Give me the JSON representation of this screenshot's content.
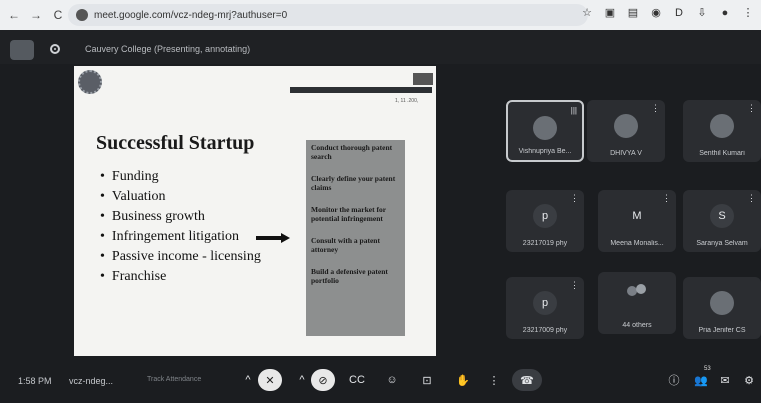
{
  "browser": {
    "back_glyph": "←",
    "forward_glyph": "→",
    "reload_glyph": "C",
    "url": "meet.google.com/vcz-ndeg-mrj?authuser=0",
    "right_icons": [
      "star-icon",
      "extension-icon",
      "extension-icon-2",
      "extension-icon-3",
      "extension-icon-4",
      "download-icon",
      "profile-icon",
      "menu-icon"
    ],
    "right_glyphs": [
      "☆",
      "▣",
      "▤",
      "◉",
      "D",
      "⇩",
      "●",
      "⋮"
    ]
  },
  "meet": {
    "presenting_label": "Cauvery College (Presenting, annotating)"
  },
  "slide": {
    "tiny_label": "1, 11 .200,",
    "title": "Successful Startup",
    "bullets": [
      "Funding",
      "Valuation",
      "Business growth",
      "Infringement litigation",
      "Passive income - licensing",
      "Franchise"
    ],
    "steps": [
      "Conduct thorough patent search",
      "Clearly define your patent claims",
      "Monitor the market for potential infringement",
      "Consult with a patent attorney",
      "Build a defensive patent portfolio"
    ]
  },
  "participants": [
    {
      "name": "Vishnupriya Be...",
      "avatar": "",
      "kind": "photo",
      "mic": "|||"
    },
    {
      "name": "DHIVYA V",
      "avatar": "",
      "kind": "photo"
    },
    {
      "name": "Senthil Kumari",
      "avatar": "",
      "kind": "photo"
    },
    {
      "name": "23217019 phy",
      "avatar": "p",
      "kind": "letter"
    },
    {
      "name": "Meena Monalis...",
      "avatar": "M",
      "kind": "plain"
    },
    {
      "name": "Saranya Selvam",
      "avatar": "S",
      "kind": "letter"
    },
    {
      "name": "23217009 phy",
      "avatar": "p",
      "kind": "letter"
    },
    {
      "name": "44 others",
      "avatar": "",
      "kind": "others"
    },
    {
      "name": "Pria Jenifer CS",
      "avatar": "",
      "kind": "photo"
    }
  ],
  "toolbar": {
    "time": "1:58 PM",
    "code": "vcz-ndeg...",
    "track": "Track Attendance",
    "people_count": "53",
    "glyphs": {
      "chevron": "^",
      "mic": "🎤",
      "cam": "⊘",
      "captions": "CC",
      "emoji": "☺",
      "present": "⊡",
      "hand": "✋",
      "more": "⋮",
      "end": "☎",
      "info": "ⓘ",
      "people": "👥",
      "chat": "✉",
      "activities": "⚙"
    }
  }
}
